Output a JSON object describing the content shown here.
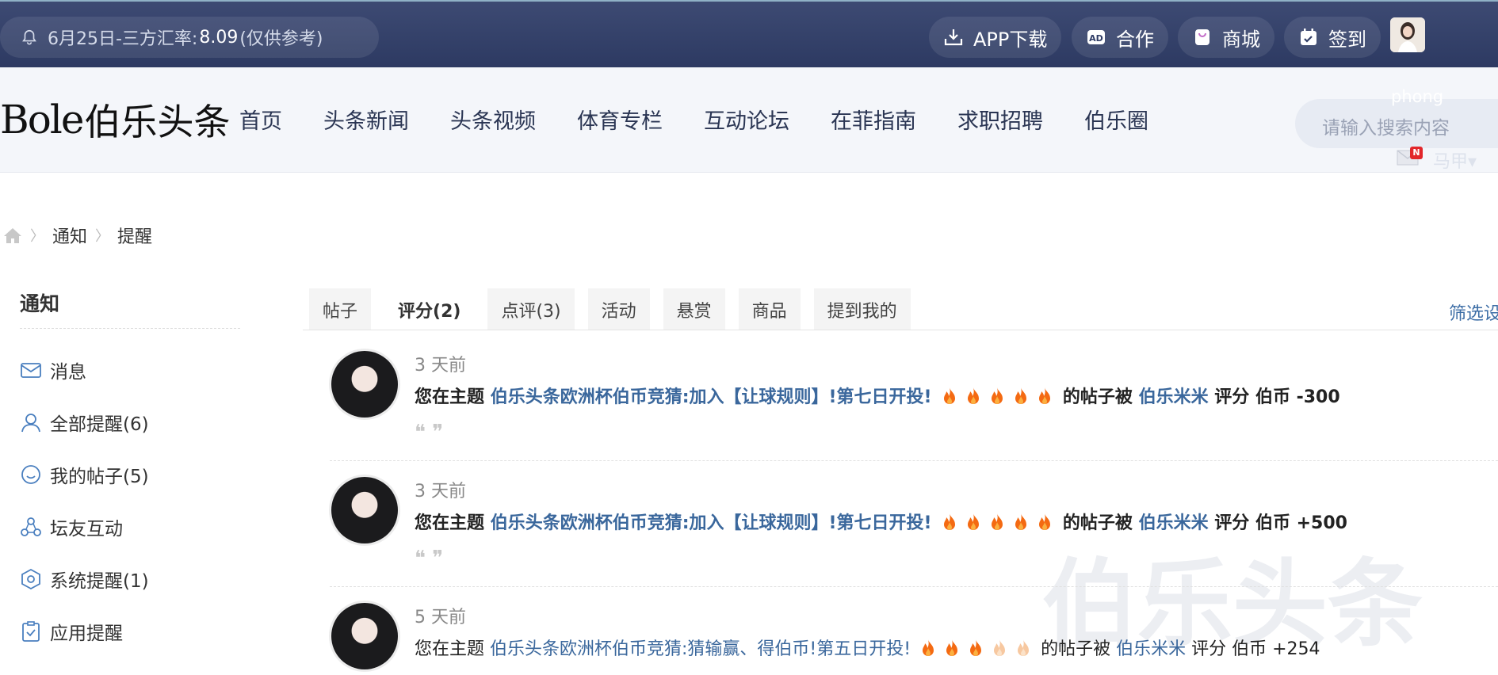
{
  "topbar": {
    "notice": {
      "prefix": "6月25日-三方汇率:",
      "rate": "8.09",
      "suffix": "(仅供参考)"
    },
    "buttons": [
      {
        "label": "APP下载",
        "icon": "download-icon"
      },
      {
        "label": "合作",
        "icon": "ad-icon"
      },
      {
        "label": "商城",
        "icon": "shopping-bag-icon"
      },
      {
        "label": "签到",
        "icon": "calendar-check-icon"
      }
    ]
  },
  "nav": {
    "logo_latin": "Bole",
    "logo_cn": "伯乐头条",
    "menu": [
      "首页",
      "头条新闻",
      "头条视频",
      "体育专栏",
      "互动论坛",
      "在菲指南",
      "求职招聘",
      "伯乐圈"
    ],
    "search_placeholder": "请输入搜索内容",
    "username_overlay": "phong",
    "mail_badge": "N",
    "user_menu": "马甲▾"
  },
  "breadcrumb": [
    "通知",
    "提醒"
  ],
  "sidebar": {
    "title": "通知",
    "items": [
      {
        "label": "消息",
        "icon": "mail-icon"
      },
      {
        "label": "全部提醒(6)",
        "icon": "user-icon"
      },
      {
        "label": "我的帖子(5)",
        "icon": "chat-bubble-icon"
      },
      {
        "label": "坛友互动",
        "icon": "network-icon"
      },
      {
        "label": "系统提醒(1)",
        "icon": "hexagon-settings-icon"
      },
      {
        "label": "应用提醒",
        "icon": "clipboard-check-icon"
      }
    ]
  },
  "tabs": [
    "帖子",
    "评分(2)",
    "点评(3)",
    "活动",
    "悬赏",
    "商品",
    "提到我的"
  ],
  "active_tab": "评分(2)",
  "filter_label": "筛选设",
  "entries": [
    {
      "time": "3 天前",
      "prefix": "您在主题",
      "topic": "伯乐头条欧洲杯伯币竞猜:加入【让球规则】!第七日开投!",
      "fires": 5,
      "middle": "的帖子被",
      "user": "伯乐米米",
      "action": "评分 伯币 -300",
      "bold": true
    },
    {
      "time": "3 天前",
      "prefix": "您在主题",
      "topic": "伯乐头条欧洲杯伯币竞猜:加入【让球规则】!第七日开投!",
      "fires": 5,
      "middle": "的帖子被",
      "user": "伯乐米米",
      "action": "评分 伯币 +500",
      "bold": true
    },
    {
      "time": "5 天前",
      "prefix": "您在主题",
      "topic": "伯乐头条欧洲杯伯币竞猜:猜输赢、得伯币!第五日开投!",
      "fires": 5,
      "fires_faded": 2,
      "middle": "的帖子被",
      "user": "伯乐米米",
      "action": "评分 伯币 +254",
      "bold": false
    }
  ],
  "quote_glyph": "❝ ❞",
  "watermark": "伯乐头条",
  "colors": {
    "topbar": "#2f3c65",
    "link": "#3a679c",
    "fire": "#f46a12"
  }
}
